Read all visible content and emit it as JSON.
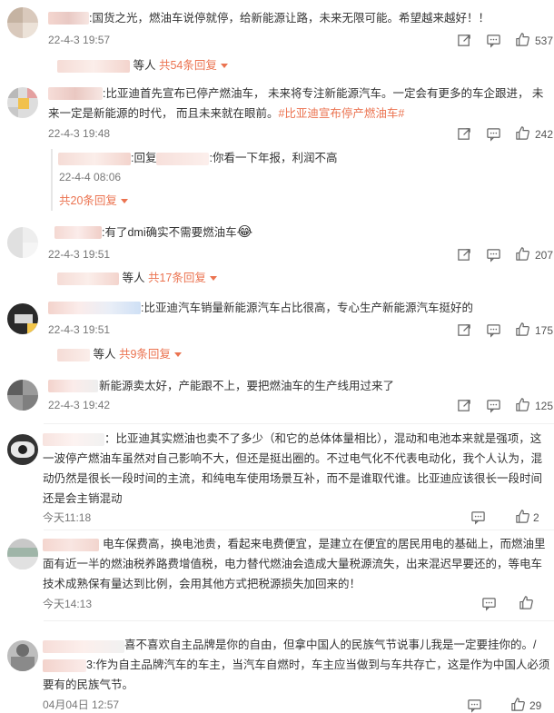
{
  "comments": [
    {
      "text": ":国货之光，燃油车说停就停，给新能源让路，未来无限可能。希望越来越好！！",
      "time": "22-4-3 19:57",
      "likes": "537",
      "replies_prefix": "等人",
      "replies_link": "共54条回复"
    },
    {
      "text_a": ":比亚迪首先宣布已停产燃油车， 未来将专注新能源汽车。一定会有更多的车企跟进， 未来一定是新能源的时代， 而且未来就在眼前。",
      "hashtag": "#比亚迪宣布停产燃油车#",
      "time": "22-4-3 19:48",
      "likes": "242",
      "sub_reply_prefix": ":回复",
      "sub_reply_text": ":你看一下年报，利润不高",
      "sub_reply_time": "22-4-4 08:06",
      "sub_reply_link": "共20条回复"
    },
    {
      "text": ":有了dmi确实不需要燃油车",
      "emoji": "😂",
      "time": "22-4-3 19:51",
      "likes": "207",
      "replies_prefix": "等人",
      "replies_link": "共17条回复"
    },
    {
      "text": ":比亚迪汽车销量新能源汽车占比很高，专心生产新能源汽车挺好的",
      "time": "22-4-3 19:51",
      "likes": "175",
      "replies_prefix": "等人",
      "replies_link": "共9条回复"
    },
    {
      "text": "新能源卖太好，产能跟不上，要把燃油车的生产线用过来了",
      "time": "22-4-3 19:42",
      "likes": "125"
    },
    {
      "text": "：比亚迪其实燃油也卖不了多少（和它的总体体量相比），混动和电池本来就是强项，这一波停产燃油车虽然对自己影响不大，但还是挺出圈的。不过电气化不代表电动化，我个人认为，混动仍然是很长一段时间的主流，和纯电车使用场景互补，而不是谁取代谁。比亚迪应该很长一段时间还是会主销混动",
      "time": "今天11:18",
      "likes": "2"
    },
    {
      "text": "电车保费高，换电池贵，看起来电费便宜，是建立在便宜的居民用电的基础上，而燃油里面有近一半的燃油税养路费增值税，电力替代燃油会造成大量税源流失，出来混迟早要还的，等电车技术成熟保有量达到比例，会用其他方式把税源损失加回来的！",
      "time": "今天14:13",
      "likes": ""
    },
    {
      "text_a": "喜不喜欢自主品牌是你的自由，但拿中国人的民族气节说事儿我是一定要挂你的。",
      "text_b": "3:作为自主品牌汽车的车主，当汽车自燃时，车主应当做到与车共存亡，这是作为中国人必须要有的民族气节。",
      "time": "04月04日 12:57",
      "likes": "29"
    }
  ],
  "colors": {
    "accent": "#eb7350",
    "text": "#333333",
    "meta": "#777777"
  },
  "icons": [
    "share-icon",
    "comment-icon",
    "like-icon"
  ]
}
